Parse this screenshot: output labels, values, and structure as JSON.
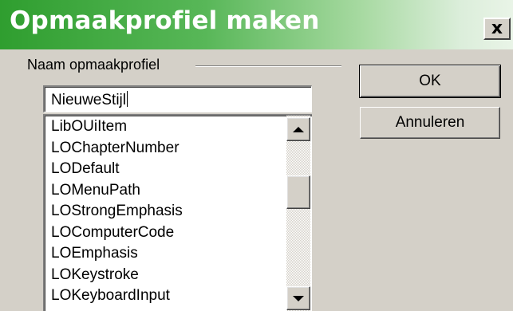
{
  "window": {
    "title": "Opmaakprofiel maken",
    "close_label": "x"
  },
  "form": {
    "group_label": "Naam opmaakprofiel",
    "name_input_value": "NieuweStijl",
    "style_list": [
      "LibOUiItem",
      "LOChapterNumber",
      "LODefault",
      "LOMenuPath",
      "LOStrongEmphasis",
      "LOComputerCode",
      "LOEmphasis",
      "LOKeystroke",
      "LOKeyboardInput"
    ]
  },
  "buttons": {
    "ok_label": "OK",
    "cancel_label": "Annuleren"
  },
  "icons": {
    "close": "close-icon",
    "scroll_up": "arrow-up-icon",
    "scroll_down": "arrow-down-icon"
  },
  "colors": {
    "titlebar_start": "#2f9e2f",
    "titlebar_end": "#e9f4e7",
    "dialog_face": "#d4d0c8"
  }
}
